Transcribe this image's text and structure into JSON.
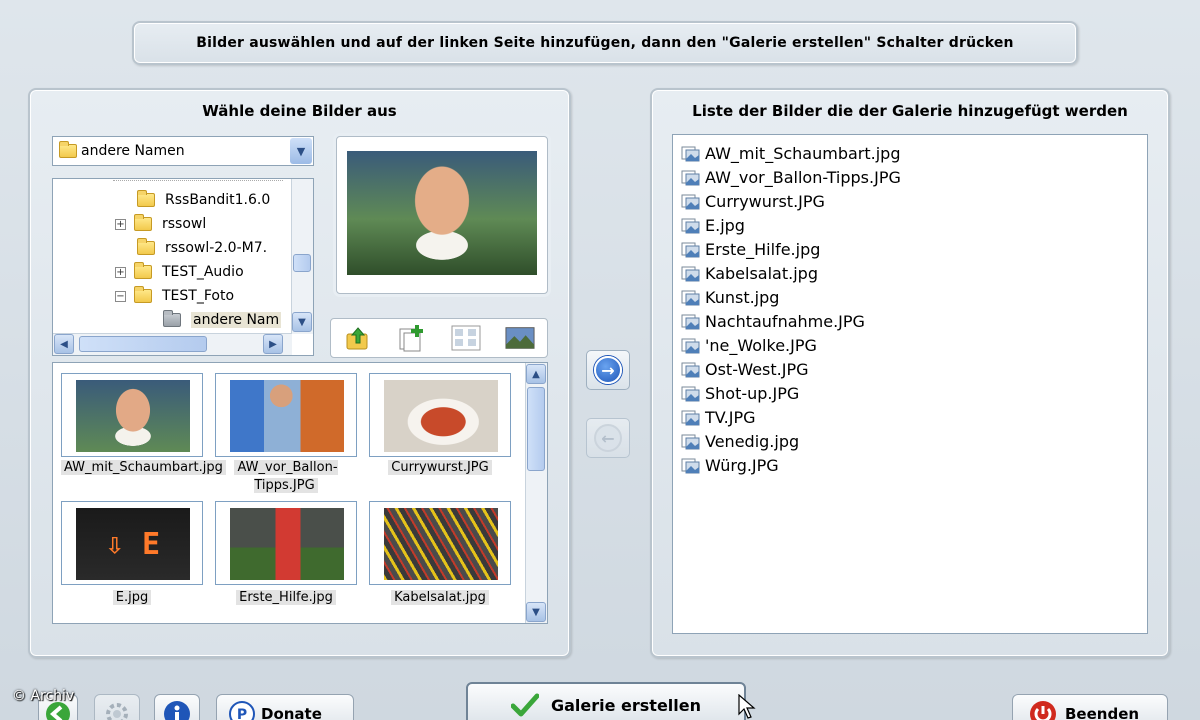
{
  "instruction": "Bilder auswählen und auf der linken Seite hinzufügen, dann den \"Galerie erstellen\" Schalter drücken",
  "left_panel": {
    "title": "Wähle deine Bilder aus",
    "folder_select": {
      "value": "andere Namen"
    },
    "tree": [
      {
        "label": "RssBandit1.6.0",
        "expander": ""
      },
      {
        "label": "rssowl",
        "expander": "+"
      },
      {
        "label": "rssowl-2.0-M7.",
        "expander": ""
      },
      {
        "label": "TEST_Audio",
        "expander": "+"
      },
      {
        "label": "TEST_Foto",
        "expander": "−"
      },
      {
        "label": "andere Nam",
        "expander": "",
        "selected": true
      }
    ],
    "thumbnails": [
      {
        "caption": "AW_mit_Schaumbart.jpg"
      },
      {
        "caption": "AW_vor_Ballon-Tipps.JPG"
      },
      {
        "caption": "Currywurst.JPG"
      },
      {
        "caption": "E.jpg"
      },
      {
        "caption": "Erste_Hilfe.jpg"
      },
      {
        "caption": "Kabelsalat.jpg"
      }
    ]
  },
  "right_panel": {
    "title": "Liste der Bilder die der Galerie hinzugefügt werden",
    "files": [
      "AW_mit_Schaumbart.jpg",
      "AW_vor_Ballon-Tipps.JPG",
      "Currywurst.JPG",
      "E.jpg",
      "Erste_Hilfe.jpg",
      "Kabelsalat.jpg",
      "Kunst.jpg",
      "Nachtaufnahme.JPG",
      "'ne_Wolke.JPG",
      "Ost-West.JPG",
      "Shot-up.JPG",
      "TV.JPG",
      "Venedig.jpg",
      "Würg.JPG"
    ]
  },
  "buttons": {
    "donate": "Donate",
    "gallery": "Galerie erstellen",
    "quit": "Beenden"
  },
  "watermark": "© Archiv",
  "colors": {
    "accent_blue": "#2f6fd0",
    "green_check": "#3aa63a",
    "quit_red": "#d02a1e"
  }
}
